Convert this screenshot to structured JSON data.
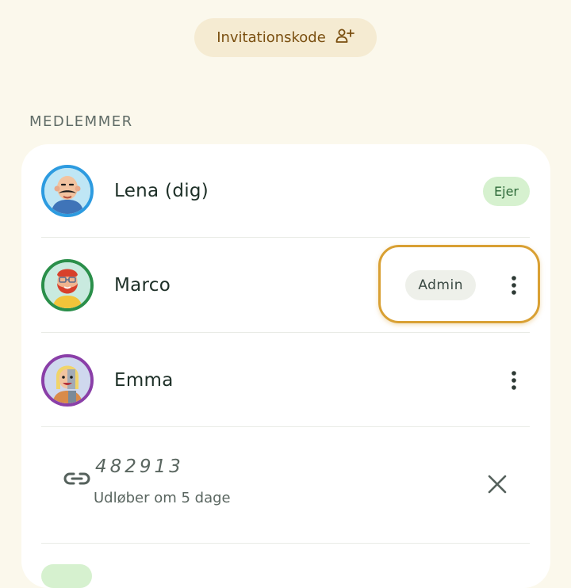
{
  "invite": {
    "label": "Invitationskode",
    "icon": "person-add-icon"
  },
  "members_section": {
    "title": "MEDLEMMER",
    "members": [
      {
        "name": "Lena (dig)",
        "badge": "Ejer",
        "ring_color": "#2d9be0"
      },
      {
        "name": "Marco",
        "badge": "Admin",
        "ring_color": "#2a8f4a"
      },
      {
        "name": "Emma",
        "badge": "",
        "ring_color": "#8a3fa8"
      }
    ],
    "invite_code": {
      "code": "482913",
      "expiry": "Udløber om 5 dage"
    }
  },
  "colors": {
    "background": "#fbf8ec",
    "accent_highlight": "#d9a033",
    "owner_badge": "#d6f1cf",
    "invite_pill": "#f5ebd2"
  }
}
